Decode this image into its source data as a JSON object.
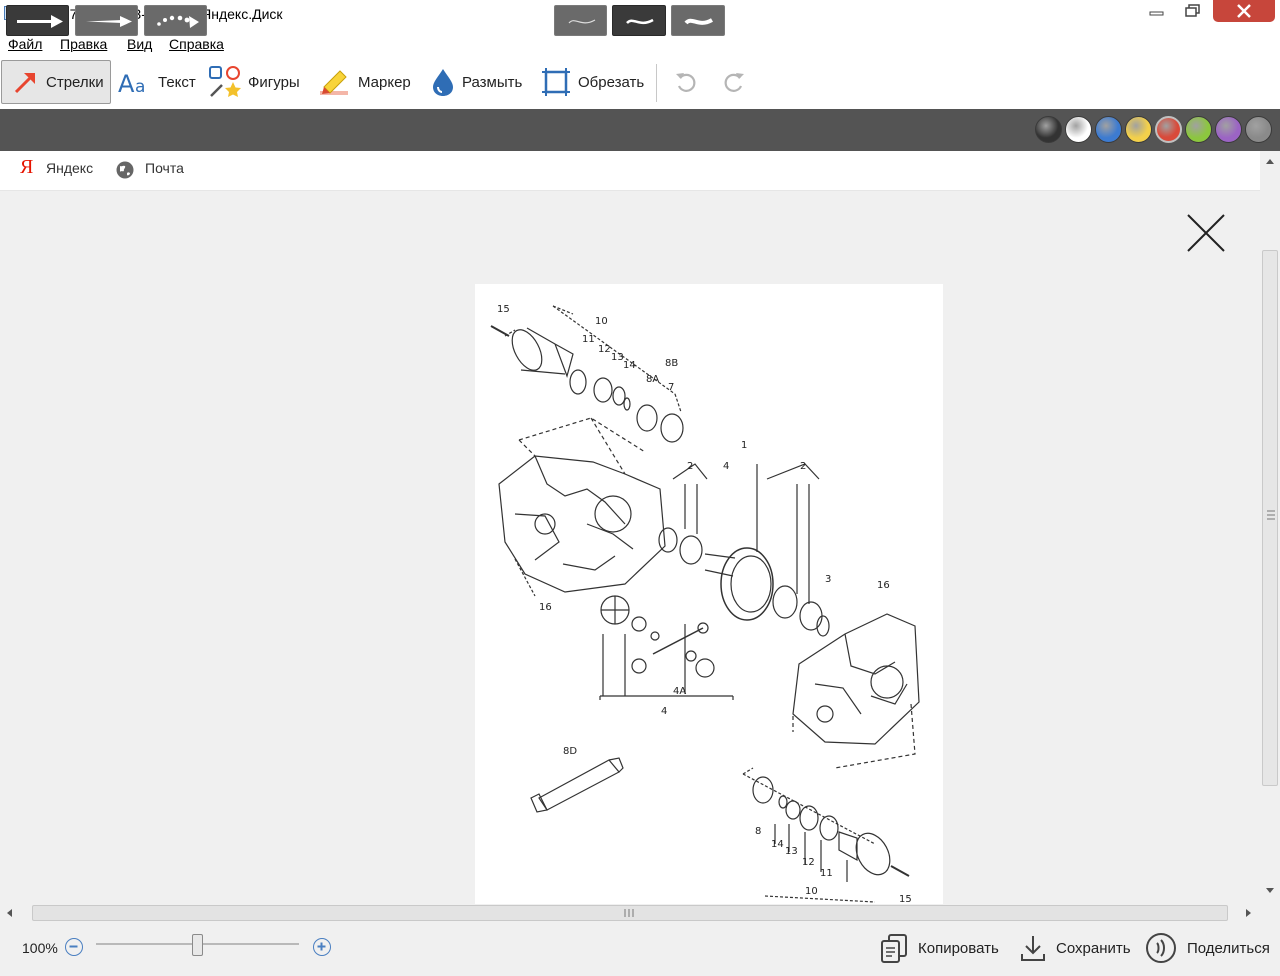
{
  "window": {
    "title": "2024-07-19_12-53-55.png - Яндекс.Диск"
  },
  "menu": [
    "Файл",
    "Правка",
    "Вид",
    "Справка"
  ],
  "tools": [
    {
      "label": "Стрелки",
      "active": true
    },
    {
      "label": "Текст"
    },
    {
      "label": "Фигуры"
    },
    {
      "label": "Маркер"
    },
    {
      "label": "Размыть"
    },
    {
      "label": "Обрезать"
    }
  ],
  "palette": [
    "#333333",
    "#ffffff",
    "#3d7bd0",
    "#f3d04b",
    "#d94a3a",
    "#8cc63f",
    "#9b64c4",
    "#8a8a8a"
  ],
  "selected_color": "#d94a3a",
  "bookmarks": [
    {
      "label": "Яндекс",
      "icon": "yandex-logo-icon"
    },
    {
      "label": "Почта",
      "icon": "globe-icon"
    }
  ],
  "diagram": {
    "labels": [
      "15",
      "10",
      "11",
      "12",
      "13",
      "14",
      "8A",
      "8B",
      "7",
      "1",
      "2",
      "4",
      "2",
      "3",
      "16",
      "16",
      "4A",
      "4",
      "8D",
      "8",
      "14",
      "13",
      "12",
      "11",
      "10",
      "15"
    ]
  },
  "zoom": {
    "label": "100%",
    "level": 0.5
  },
  "actions": {
    "copy": "Копировать",
    "save": "Сохранить",
    "share": "Поделиться"
  }
}
